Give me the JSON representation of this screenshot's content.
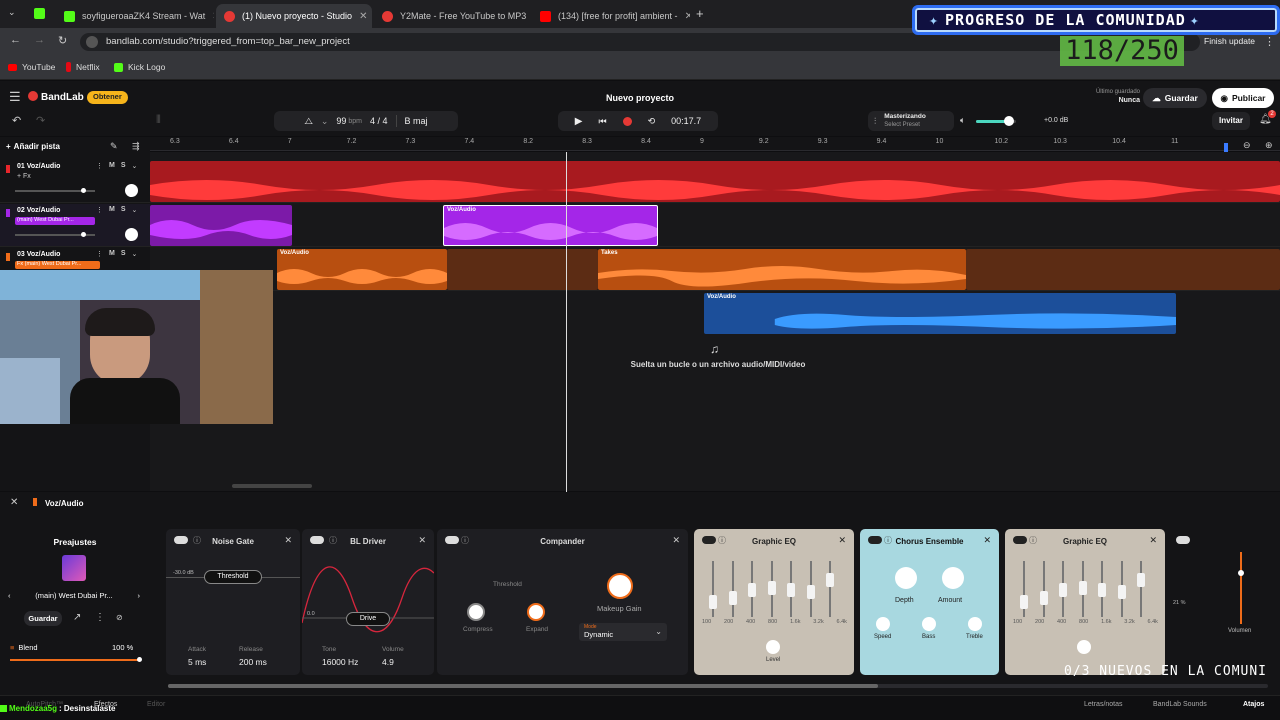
{
  "browser": {
    "tabs": [
      {
        "label": "soyfigueroaaZK4 Stream - Wat",
        "color": "#53fc18"
      },
      {
        "label": "(1) Nuevo proyecto - Studio",
        "color": "#e53935"
      },
      {
        "label": "Y2Mate - Free YouTube to MP3",
        "color": "#e53935"
      },
      {
        "label": "(134) [free for profit] ambient -",
        "color": "#ff0000"
      }
    ],
    "url": "bandlab.com/studio?triggered_from=top_bar_new_project",
    "finish_update": "Finish update",
    "bookmarks": [
      {
        "label": "YouTube",
        "color": "#ff0000"
      },
      {
        "label": "Netflix",
        "color": "#e50914"
      },
      {
        "label": "Kick Logo",
        "color": "#53fc18"
      }
    ]
  },
  "overlay": {
    "banner": "PROGRESO DE LA COMUNIDAD",
    "counter": "118/250",
    "ticker": "0/3 NUEVOS EN LA COMUNI",
    "chat_user": "Mendozaa5g",
    "chat_msg": ": Desinstalaste"
  },
  "app": {
    "logo": "BandLab",
    "obtain": "Obtener",
    "project_title": "Nuevo proyecto",
    "last_saved_label": "Último guardado",
    "last_saved_value": "Nunca",
    "save": "Guardar",
    "publish": "Publicar",
    "invite": "Invitar",
    "notif_count": "2",
    "tempo": "99",
    "tempo_unit": "bpm",
    "time_sig": "4 / 4",
    "key": "B maj",
    "time": "00:17.7",
    "mastering_title": "Masterizando",
    "mastering_sub": "Select Preset",
    "volume_db": "+0.0 dB",
    "add_track": "Añadir pista",
    "drop_hint": "Suelta un bucle o un archivo audio/MIDI/video",
    "ruler": [
      "6.3",
      "6.4",
      "7",
      "7.2",
      "7.3",
      "7.4",
      "8.2",
      "8.3",
      "8.4",
      "9",
      "9.2",
      "9.3",
      "9.4",
      "10",
      "10.2",
      "10.3",
      "10.4",
      "11"
    ]
  },
  "tracks": [
    {
      "name": "01  Voz/Audio",
      "fx": "+ Fx",
      "color": "#e8262b"
    },
    {
      "name": "02  Voz/Audio",
      "fx": "(main) West Dubai Pr...",
      "color": "#a426e8"
    },
    {
      "name": "03  Voz/Audio",
      "fx": "Fx (main) West Dubai Pr...",
      "color": "#ef6c1a"
    }
  ],
  "clips": {
    "label": "Voz/Audio",
    "takes": "Takes"
  },
  "fx": {
    "track": "Voz/Audio",
    "presets_title": "Preajustes",
    "preset_name": "(main) West Dubai Pr...",
    "save": "Guardar",
    "blend_label": "Blend",
    "blend_value": "100 %",
    "noise_gate": {
      "title": "Noise Gate",
      "threshold": "Threshold",
      "db": "-30.0 dB",
      "attack_label": "Attack",
      "attack": "5 ms",
      "release_label": "Release",
      "release": "200 ms"
    },
    "driver": {
      "title": "BL Driver",
      "drive": "Drive",
      "zero": "0.0",
      "tone_label": "Tone",
      "tone": "16000 Hz",
      "volume_label": "Volume",
      "volume": "4.9"
    },
    "compander": {
      "title": "Compander",
      "threshold": "Threshold",
      "compress": "Compress",
      "expand": "Expand",
      "makeup": "Makeup Gain",
      "mode_label": "Mode",
      "mode": "Dynamic"
    },
    "eq1": {
      "title": "Graphic EQ",
      "level": "Level",
      "bands": [
        "100",
        "200",
        "400",
        "800",
        "1.6k",
        "3.2k",
        "6.4k"
      ]
    },
    "chorus": {
      "title": "Chorus Ensemble",
      "depth": "Depth",
      "amount": "Amount",
      "speed": "Speed",
      "bass": "Bass",
      "treble": "Treble"
    },
    "eq2": {
      "title": "Graphic EQ",
      "bands": [
        "100",
        "200",
        "400",
        "800",
        "1.6k",
        "3.2k",
        "6.4k"
      ]
    },
    "volume_label": "Volumen",
    "pct": "21 %"
  },
  "bottom": {
    "autopitch": "AutoPitch™",
    "effects": "Efectos",
    "editor": "Editor",
    "lyrics": "Letras/notas",
    "sounds": "BandLab Sounds",
    "shortcuts": "Atajos"
  }
}
